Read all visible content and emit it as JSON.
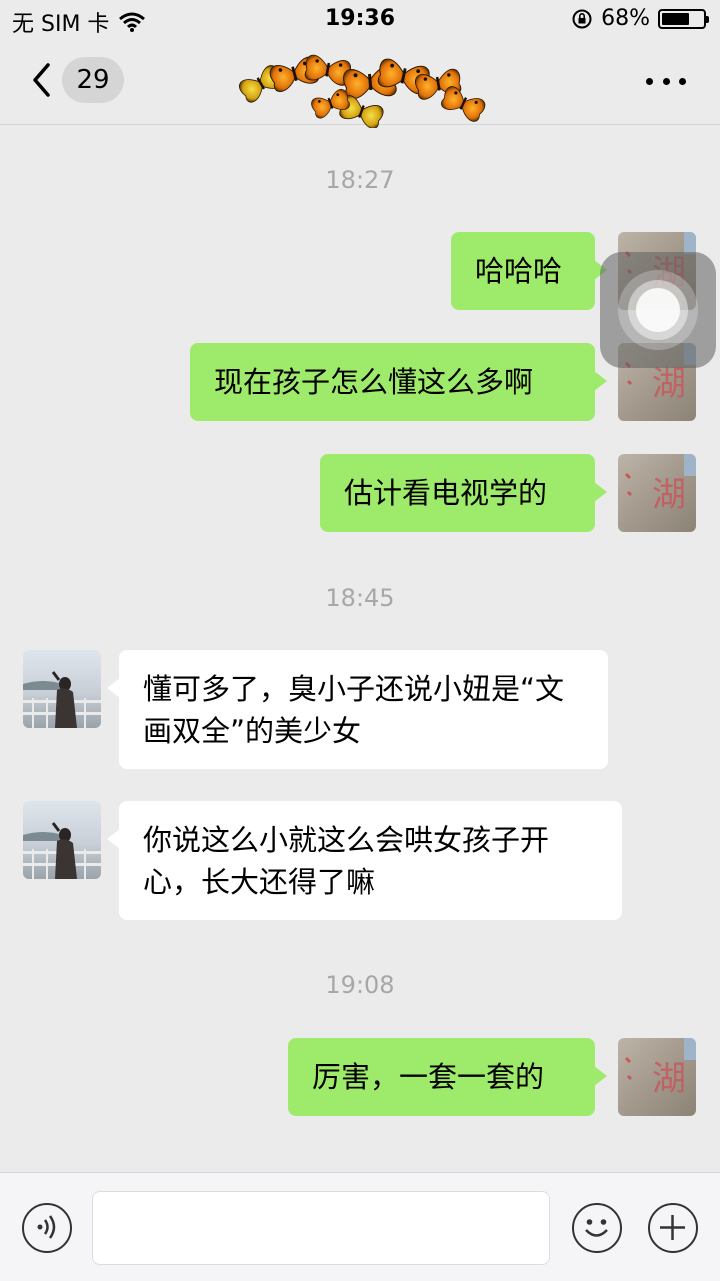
{
  "status_bar": {
    "carrier": "无 SIM 卡",
    "time": "19:36",
    "battery_percent": "68%",
    "battery_level": 0.68,
    "icons": [
      "wifi-icon",
      "orientation-lock-icon",
      "battery-icon"
    ]
  },
  "nav": {
    "unread_count": "29",
    "title_image": "butterflies-title-decoration",
    "icons": [
      "back-chevron-icon",
      "more-icon"
    ]
  },
  "messages": {
    "ts1": "18:27",
    "m1": "哈哈哈",
    "m2": "现在孩子怎么懂这么多啊",
    "m3": "估计看电视学的",
    "ts2": "18:45",
    "m4": "懂可多了，臭小子还说小妞是“文画双全”的美少女",
    "m5": "你说这么小就这么会哄女孩子开心，长大还得了嘛",
    "ts3": "19:08",
    "m6": "厉害，一套一套的"
  },
  "input_bar": {
    "value": "",
    "icons": [
      "voice-icon",
      "emoji-icon",
      "plus-icon"
    ]
  },
  "colors": {
    "background": "#ebebeb",
    "outgoing_bubble": "#9eea6a",
    "incoming_bubble": "#ffffff",
    "timestamp": "#a7a7a7"
  }
}
